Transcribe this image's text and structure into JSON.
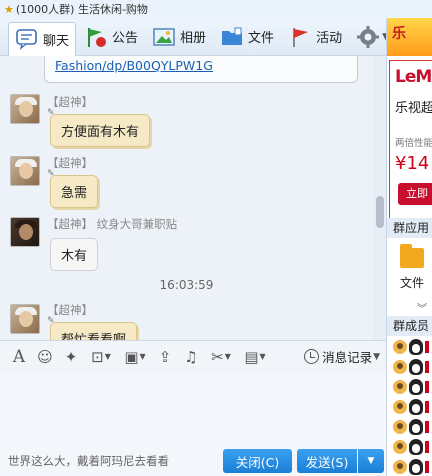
{
  "window": {
    "title": "(1000人群) 生活休闲-购物"
  },
  "tabs": [
    {
      "label": "聊天",
      "icon": "chat-bubble-icon"
    },
    {
      "label": "公告",
      "icon": "announcement-flag-icon"
    },
    {
      "label": "相册",
      "icon": "photo-album-icon"
    },
    {
      "label": "文件",
      "icon": "folder-icon"
    },
    {
      "label": "活动",
      "icon": "activity-flag-icon"
    },
    {
      "label": "",
      "icon": "gear-icon"
    }
  ],
  "messages": [
    {
      "type": "link",
      "text": "Fashion/dp/B00QYLPW1G"
    },
    {
      "sender": "【超神】",
      "text": "方便面有木有",
      "style": "yellow"
    },
    {
      "sender": "【超神】",
      "text": "急需",
      "style": "yellow"
    },
    {
      "sender": "【超神】 纹身大哥兼职贴",
      "text": "木有",
      "style": "grey"
    },
    {
      "type": "time",
      "text": "16:03:59"
    },
    {
      "sender": "【超神】",
      "text": "帮忙看看啊",
      "style": "yellow"
    }
  ],
  "toolbar": {
    "tools": [
      "font-icon",
      "emoji-icon",
      "magic-wand-icon",
      "screenshot-icon",
      "image-icon",
      "upload-icon",
      "music-icon",
      "scissors-icon",
      "remote-icon"
    ],
    "history_label": "消息记录"
  },
  "input": {
    "signature": "世界这么大，戴着阿玛尼去看看"
  },
  "buttons": {
    "close": "关闭(C)",
    "send": "发送(S)"
  },
  "sidebar": {
    "ad_brand": "LeM",
    "ad_line1": "乐视超",
    "ad_line2": "两倍性能",
    "ad_price": "¥14",
    "ad_button": "立即",
    "apps_header": "群应用",
    "app_file": "文件",
    "members_header": "群成员"
  },
  "colors": {
    "accent": "#1a7fd6",
    "bubble_yellow": "#f5e9c6",
    "link": "#1a5fb4",
    "ad_red": "#c8102e"
  }
}
